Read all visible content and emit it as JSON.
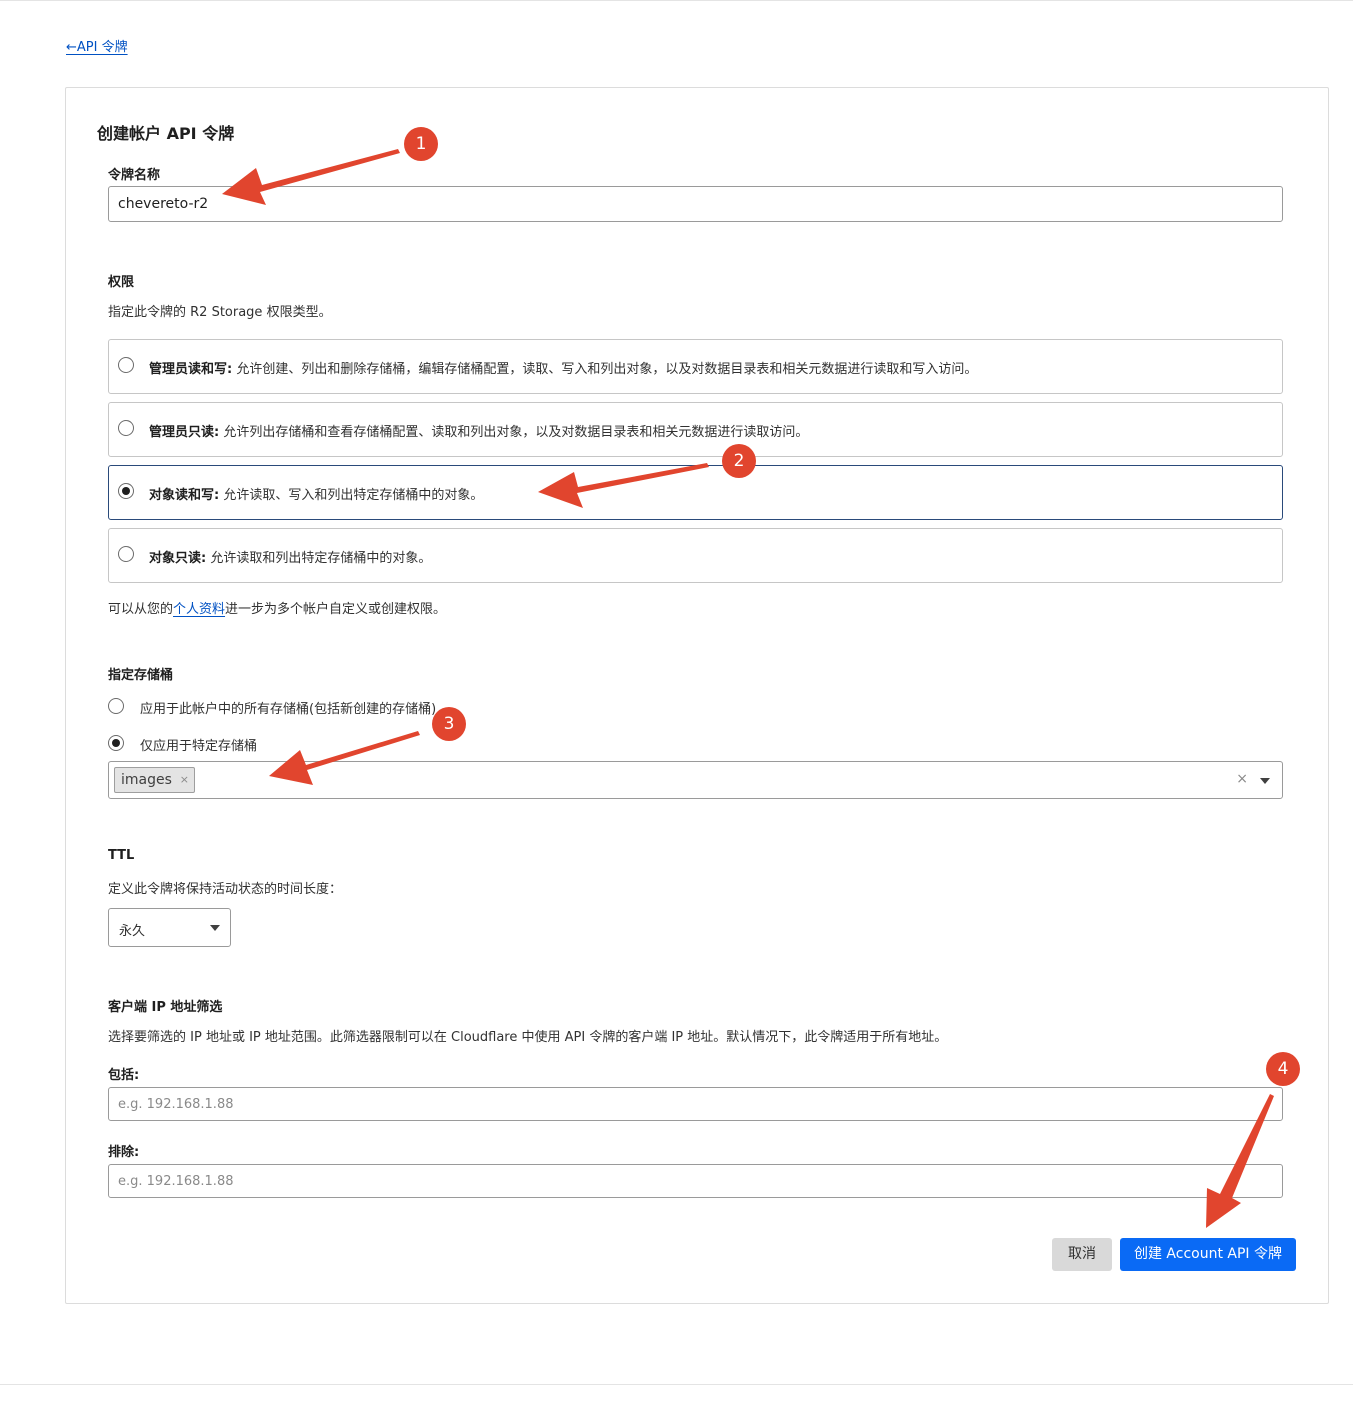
{
  "nav": {
    "back_label": "←API 令牌"
  },
  "form": {
    "title": "创建帐户 API 令牌",
    "token_name": {
      "label": "令牌名称",
      "value": "chevereto-r2"
    },
    "permissions": {
      "label": "权限",
      "description": "指定此令牌的 R2 Storage 权限类型。",
      "options": [
        {
          "title": "管理员读和写:",
          "text": " 允许创建、列出和删除存储桶，编辑存储桶配置，读取、写入和列出对象，以及对数据目录表和相关元数据进行读取和写入访问。",
          "selected": false
        },
        {
          "title": "管理员只读:",
          "text": " 允许列出存储桶和查看存储桶配置、读取和列出对象，以及对数据目录表和相关元数据进行读取访问。",
          "selected": false
        },
        {
          "title": "对象读和写:",
          "text": " 允许读取、写入和列出特定存储桶中的对象。",
          "selected": true
        },
        {
          "title": "对象只读:",
          "text": " 允许读取和列出特定存储桶中的对象。",
          "selected": false
        }
      ],
      "note_prefix": "可以从您的",
      "note_link": "个人资料",
      "note_suffix": "进一步为多个帐户自定义或创建权限。"
    },
    "buckets": {
      "label": "指定存储桶",
      "option_all": "应用于此帐户中的所有存储桶(包括新创建的存储桶)",
      "option_specific": "仅应用于特定存储桶",
      "selected_option": "specific",
      "selected_tags": [
        "images"
      ],
      "tag_remove_glyph": "×",
      "clear_glyph": "×"
    },
    "ttl": {
      "label": "TTL",
      "description": "定义此令牌将保持活动状态的时间长度：",
      "value": "永久"
    },
    "ip_filter": {
      "label": "客户端 IP 地址筛选",
      "description": "选择要筛选的 IP 地址或 IP 地址范围。此筛选器限制可以在 Cloudflare 中使用 API 令牌的客户端 IP 地址。默认情况下，此令牌适用于所有地址。",
      "include_label": "包括:",
      "include_placeholder": "e.g. 192.168.1.88",
      "exclude_label": "排除:",
      "exclude_placeholder": "e.g. 192.168.1.88"
    },
    "actions": {
      "cancel": "取消",
      "submit": "创建 Account API 令牌"
    }
  },
  "annotations": {
    "markers": [
      "1",
      "2",
      "3",
      "4"
    ],
    "color": "#e1452e"
  },
  "colors": {
    "primary": "#0a6af5",
    "link": "#0051c3"
  }
}
